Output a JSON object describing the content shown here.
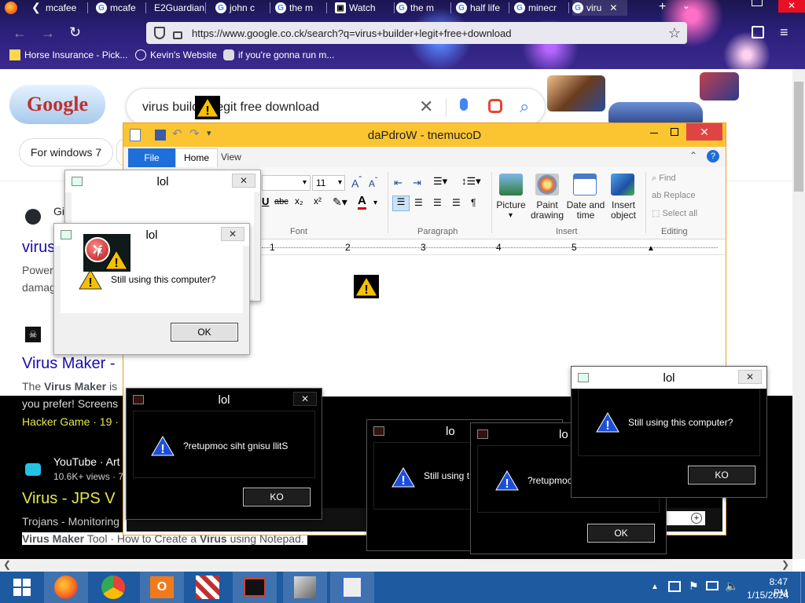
{
  "browser": {
    "tabs": [
      {
        "label": "mcafee"
      },
      {
        "label": "mcafe"
      },
      {
        "label": "E2Guardian"
      },
      {
        "label": "john c"
      },
      {
        "label": "the m"
      },
      {
        "label": "Watch"
      },
      {
        "label": "the m"
      },
      {
        "label": "half life"
      },
      {
        "label": "minecr"
      },
      {
        "label": "viru"
      }
    ],
    "url": "https://www.google.co.ck/search?q=virus+builder+legit+free+download",
    "bookmarks": [
      {
        "label": "Horse Insurance - Pick..."
      },
      {
        "label": "Kevin's Website"
      },
      {
        "label": "if you're gonna run m..."
      }
    ]
  },
  "google": {
    "logo": "Google",
    "query": "virus builder legit free download",
    "chip": "For windows 7",
    "results": [
      {
        "site": "Gi",
        "title": "virus",
        "snippet1": "Power",
        "snippet2": "damag"
      },
      {
        "title": "Virus Maker -",
        "snippet_prefix": "The ",
        "snippet_bold": "Virus Maker",
        "snippet_rest": " is",
        "snippet2": "you prefer! Screens",
        "meta": "Hacker Game · 19 ·"
      },
      {
        "site": "YouTube · Art",
        "views": "10.6K+ views · 7",
        "title": "Virus - JPS V",
        "snippet1": "Trojans - Monitoring",
        "snippet2_bold": "Virus Maker",
        "snippet2_rest": " Tool · How to Create a ",
        "snippet2_bold2": "Virus",
        "snippet2_end": " using Notepad."
      }
    ]
  },
  "wordpad": {
    "title": "daPdroW - tnemucoD",
    "tabs": {
      "file": "File",
      "home": "Home",
      "view": "View"
    },
    "font_size": "11",
    "groups": {
      "font": "Font",
      "paragraph": "Paragraph",
      "insert": "Insert",
      "editing": "Editing"
    },
    "insert_items": {
      "picture": "Picture",
      "paint": "Paint drawing",
      "datetime": "Date and time",
      "object": "Insert object"
    },
    "editing_items": {
      "find": "Find",
      "replace": "Replace",
      "select_all": "Select all"
    },
    "ruler": [
      "1",
      "2",
      "3",
      "4",
      "5"
    ]
  },
  "dialogs": {
    "title": "lol",
    "message": "Still using this computer?",
    "message_reversed": "?retupmoc siht gnisu llitS",
    "message_partial": "Still using t",
    "message_reversed_partial": "?retupmoc",
    "ok": "OK",
    "ok_reversed": "KO",
    "title_partial": "lo"
  },
  "taskbar": {
    "time": "8:47 PM",
    "date": "1/15/2024"
  }
}
